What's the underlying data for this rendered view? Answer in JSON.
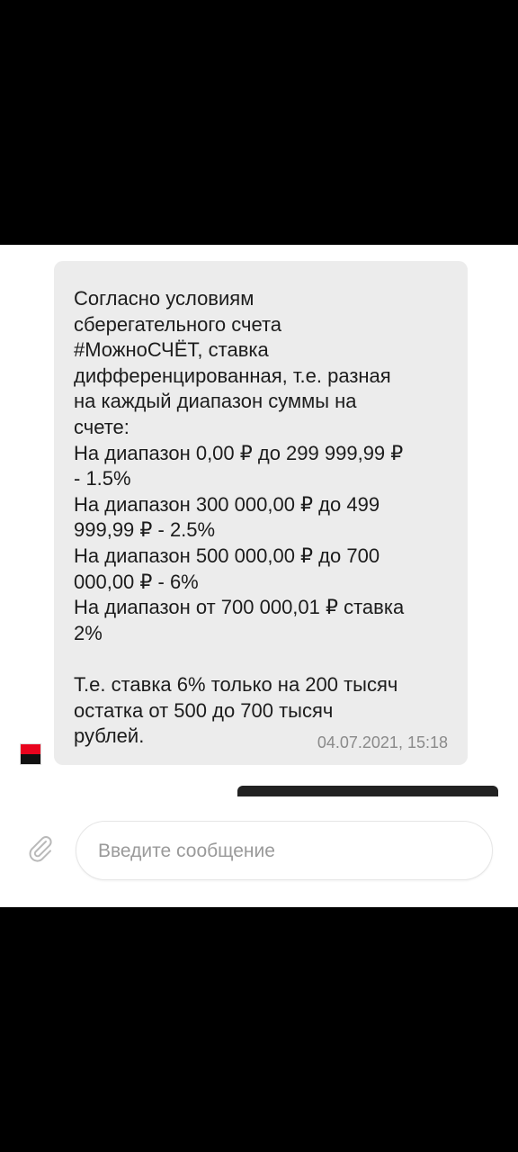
{
  "message": {
    "lines": [
      "Согласно условиям",
      "сберегательного счета",
      "#МожноСЧЁТ, ставка",
      "дифференцированная, т.е. разная",
      "на каждый диапазон суммы на",
      "счете:",
      "На диапазон 0,00 ₽ до 299 999,99 ₽",
      "- 1.5%",
      "На диапазон 300 000,00 ₽ до 499",
      "999,99 ₽  - 2.5%",
      "На диапазон 500 000,00 ₽ до 700",
      "000,00 ₽ - 6%",
      "На диапазон от 700 000,01 ₽ ставка",
      "2%",
      "",
      "Т.е. ставка 6% только на 200 тысяч",
      "остатка от 500 до 700 тысяч",
      "рублей."
    ],
    "timestamp": "04.07.2021, 15:18"
  },
  "composer": {
    "placeholder": "Введите сообщение",
    "value": ""
  },
  "icons": {
    "attach": "paperclip-icon",
    "sender": "bank-logo-icon"
  },
  "colors": {
    "bubble": "#ececec",
    "logo_red": "#e9041e",
    "logo_black": "#111111"
  }
}
